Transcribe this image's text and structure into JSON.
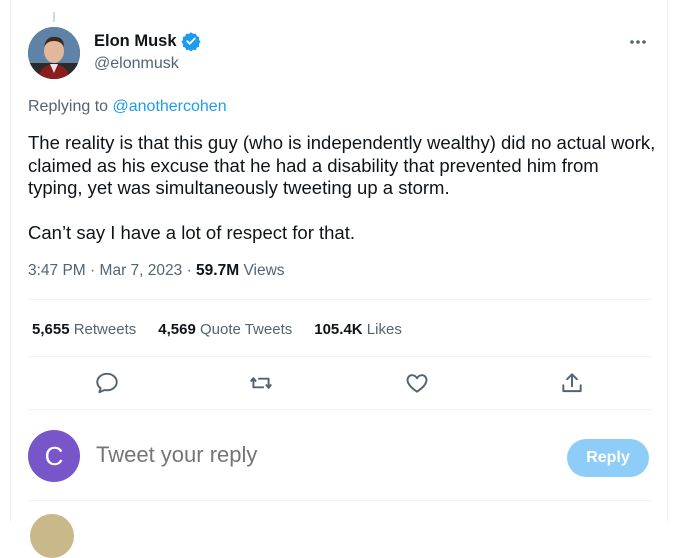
{
  "tweet": {
    "author": {
      "display_name": "Elon Musk",
      "handle": "@elonmusk",
      "verified_icon": "verified-badge-icon",
      "avatar": "profile-photo"
    },
    "more_icon": "more-options-icon",
    "replying_prefix": "Replying to",
    "replying_to": "@anothercohen",
    "text_paragraphs": [
      "The reality is that this guy (who is independently wealthy) did no actual work, claimed as his excuse that he had a disability that prevented him from typing, yet was simultaneously tweeting up a storm.",
      "Can’t say I have a lot of respect for that."
    ],
    "time": "3:47 PM",
    "separator": "·",
    "date": "Mar 7, 2023",
    "views_count": "59.7M",
    "views_label": "Views"
  },
  "stats": {
    "retweets_count": "5,655",
    "retweets_label": "Retweets",
    "quote_count": "4,569",
    "quote_label": "Quote Tweets",
    "likes_count": "105.4K",
    "likes_label": "Likes"
  },
  "actions": [
    "reply-icon",
    "retweet-icon",
    "like-icon",
    "share-icon"
  ],
  "reply_box": {
    "avatar_letter": "C",
    "placeholder": "Tweet your reply",
    "button_label": "Reply"
  },
  "colors": {
    "accent": "#1d9bf0",
    "reply_button_disabled": "#8ecdf8",
    "reply_avatar": "#7856c9",
    "secondary_text": "#536471"
  }
}
